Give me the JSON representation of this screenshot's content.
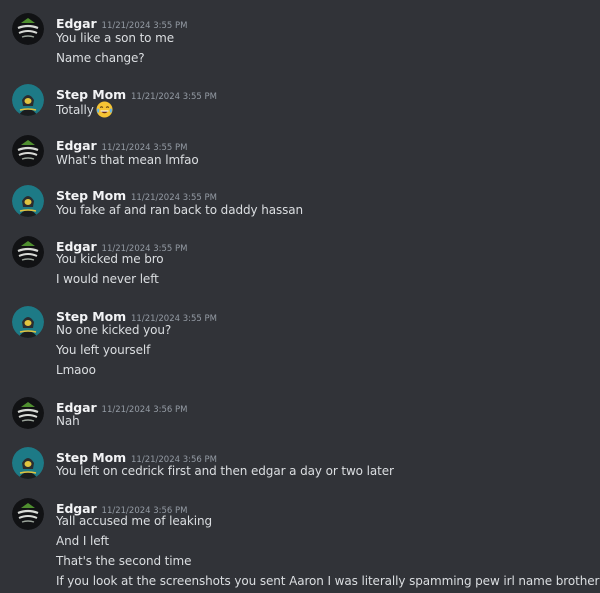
{
  "messages": [
    {
      "author": "Edgar",
      "avatar": "edgar-logo-avatar",
      "timestamp": "11/21/2024 3:55 PM",
      "lines": [
        "You like a son to me",
        "Name change?"
      ]
    },
    {
      "author": "Step Mom",
      "avatar": "hooded-figure-avatar",
      "timestamp": "11/21/2024 3:55 PM",
      "lines": [
        "Totally"
      ],
      "emoji": "laughing-tears-emoji"
    },
    {
      "author": "Edgar",
      "avatar": "edgar-logo-avatar",
      "timestamp": "11/21/2024 3:55 PM",
      "lines": [
        "What's that mean lmfao"
      ]
    },
    {
      "author": "Step Mom",
      "avatar": "hooded-figure-avatar",
      "timestamp": "11/21/2024 3:55 PM",
      "lines": [
        "You fake af and ran back to daddy hassan"
      ]
    },
    {
      "author": "Edgar",
      "avatar": "edgar-logo-avatar",
      "timestamp": "11/21/2024 3:55 PM",
      "lines": [
        "You kicked me bro",
        "I would never left"
      ]
    },
    {
      "author": "Step Mom",
      "avatar": "hooded-figure-avatar",
      "timestamp": "11/21/2024 3:55 PM",
      "lines": [
        "No one kicked you?",
        "You left yourself",
        "Lmaoo"
      ]
    },
    {
      "author": "Edgar",
      "avatar": "edgar-logo-avatar",
      "timestamp": "11/21/2024 3:56 PM",
      "lines": [
        "Nah"
      ]
    },
    {
      "author": "Step Mom",
      "avatar": "hooded-figure-avatar",
      "timestamp": "11/21/2024 3:56 PM",
      "lines": [
        "You left on cedrick first and then edgar a day or two later"
      ]
    },
    {
      "author": "Edgar",
      "avatar": "edgar-logo-avatar",
      "timestamp": "11/21/2024 3:56 PM",
      "lines": [
        "Yall accused me of leaking",
        "And I left",
        "That's the second time",
        "If you look at the screenshots you sent Aaron I was literally spamming pew irl name brother"
      ]
    }
  ],
  "colors": {
    "background": "#313338",
    "author": "#f2f3f5",
    "text": "#dbdee1",
    "timestamp": "#949ba4"
  }
}
